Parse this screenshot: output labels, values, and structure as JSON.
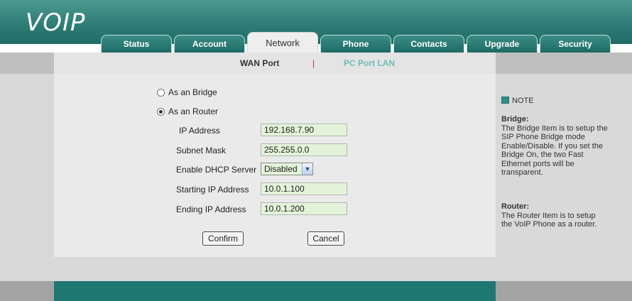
{
  "app": {
    "logo": "VOIP"
  },
  "tabs": [
    "Status",
    "Account",
    "Network",
    "Phone",
    "Contacts",
    "Upgrade",
    "Security"
  ],
  "active_tab": "Network",
  "subnav": {
    "wan": "WAN Port",
    "separator": "|",
    "pc_lan": "PC Port LAN"
  },
  "form": {
    "bridge_label": "As an Bridge",
    "router_label": "As an Router",
    "selected_mode": "router",
    "ip_label": "IP Address",
    "ip_value": "192.168.7.90",
    "subnet_label": "Subnet Mask",
    "subnet_value": "255.255.0.0",
    "dhcp_label": "Enable DHCP Server",
    "dhcp_value": "Disabled",
    "start_label": "Starting IP Address",
    "start_value": "10.0.1.100",
    "end_label": "Ending IP Address",
    "end_value": "10.0.1.200",
    "confirm": "Confirm",
    "cancel": "Cancel"
  },
  "note": {
    "heading": "NOTE",
    "bridge_title": "Bridge:",
    "bridge_text": "The Bridge Item is to setup the SIP Phone Bridge mode Enable/Disable. If you set the Bridge On, the two Fast Ethernet ports will be transparent.",
    "router_title": "Router:",
    "router_text": "The Router Item is to setup the VoIP Phone as a router."
  },
  "colors": {
    "header": "#2f7d77",
    "field_bg": "#e2f3d9",
    "footer": "#1f7872"
  }
}
